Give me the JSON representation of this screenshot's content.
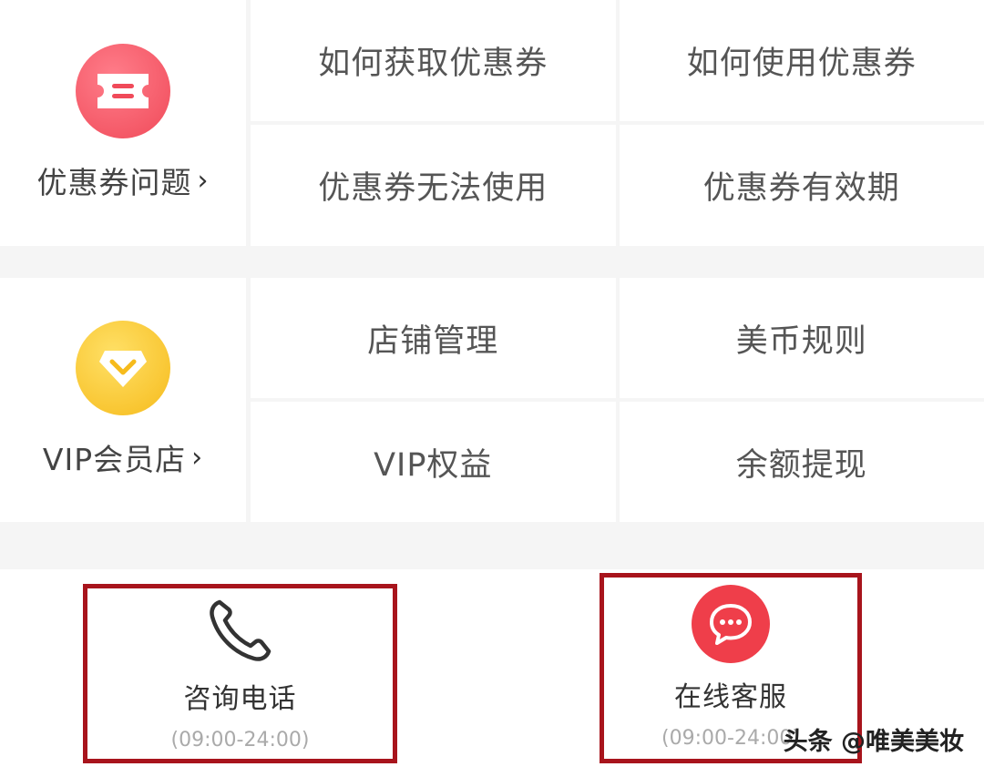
{
  "coupon_section": {
    "category_label": "优惠券问题",
    "chevron": "›",
    "icon": "ticket-icon",
    "items": [
      {
        "label": "如何获取优惠券"
      },
      {
        "label": "如何使用优惠券"
      },
      {
        "label": "优惠券无法使用"
      },
      {
        "label": "优惠券有效期"
      }
    ]
  },
  "vip_section": {
    "category_label": "VIP会员店",
    "chevron": "›",
    "icon": "diamond-icon",
    "items": [
      {
        "label": "店铺管理"
      },
      {
        "label": "美币规则"
      },
      {
        "label": "VIP权益"
      },
      {
        "label": "余额提现"
      }
    ]
  },
  "contact": {
    "phone": {
      "label": "咨询电话",
      "hours": "(09:00-24:00)",
      "icon": "phone-icon"
    },
    "online": {
      "label": "在线客服",
      "hours": "(09:00-24:00)",
      "icon": "chat-bubble-icon"
    }
  },
  "watermark": "头条 @唯美美妆",
  "colors": {
    "coupon_icon": "#f04a59",
    "vip_icon": "#f6bb1c",
    "chat_icon": "#ef3e4a",
    "highlight_border": "#a8141c"
  }
}
